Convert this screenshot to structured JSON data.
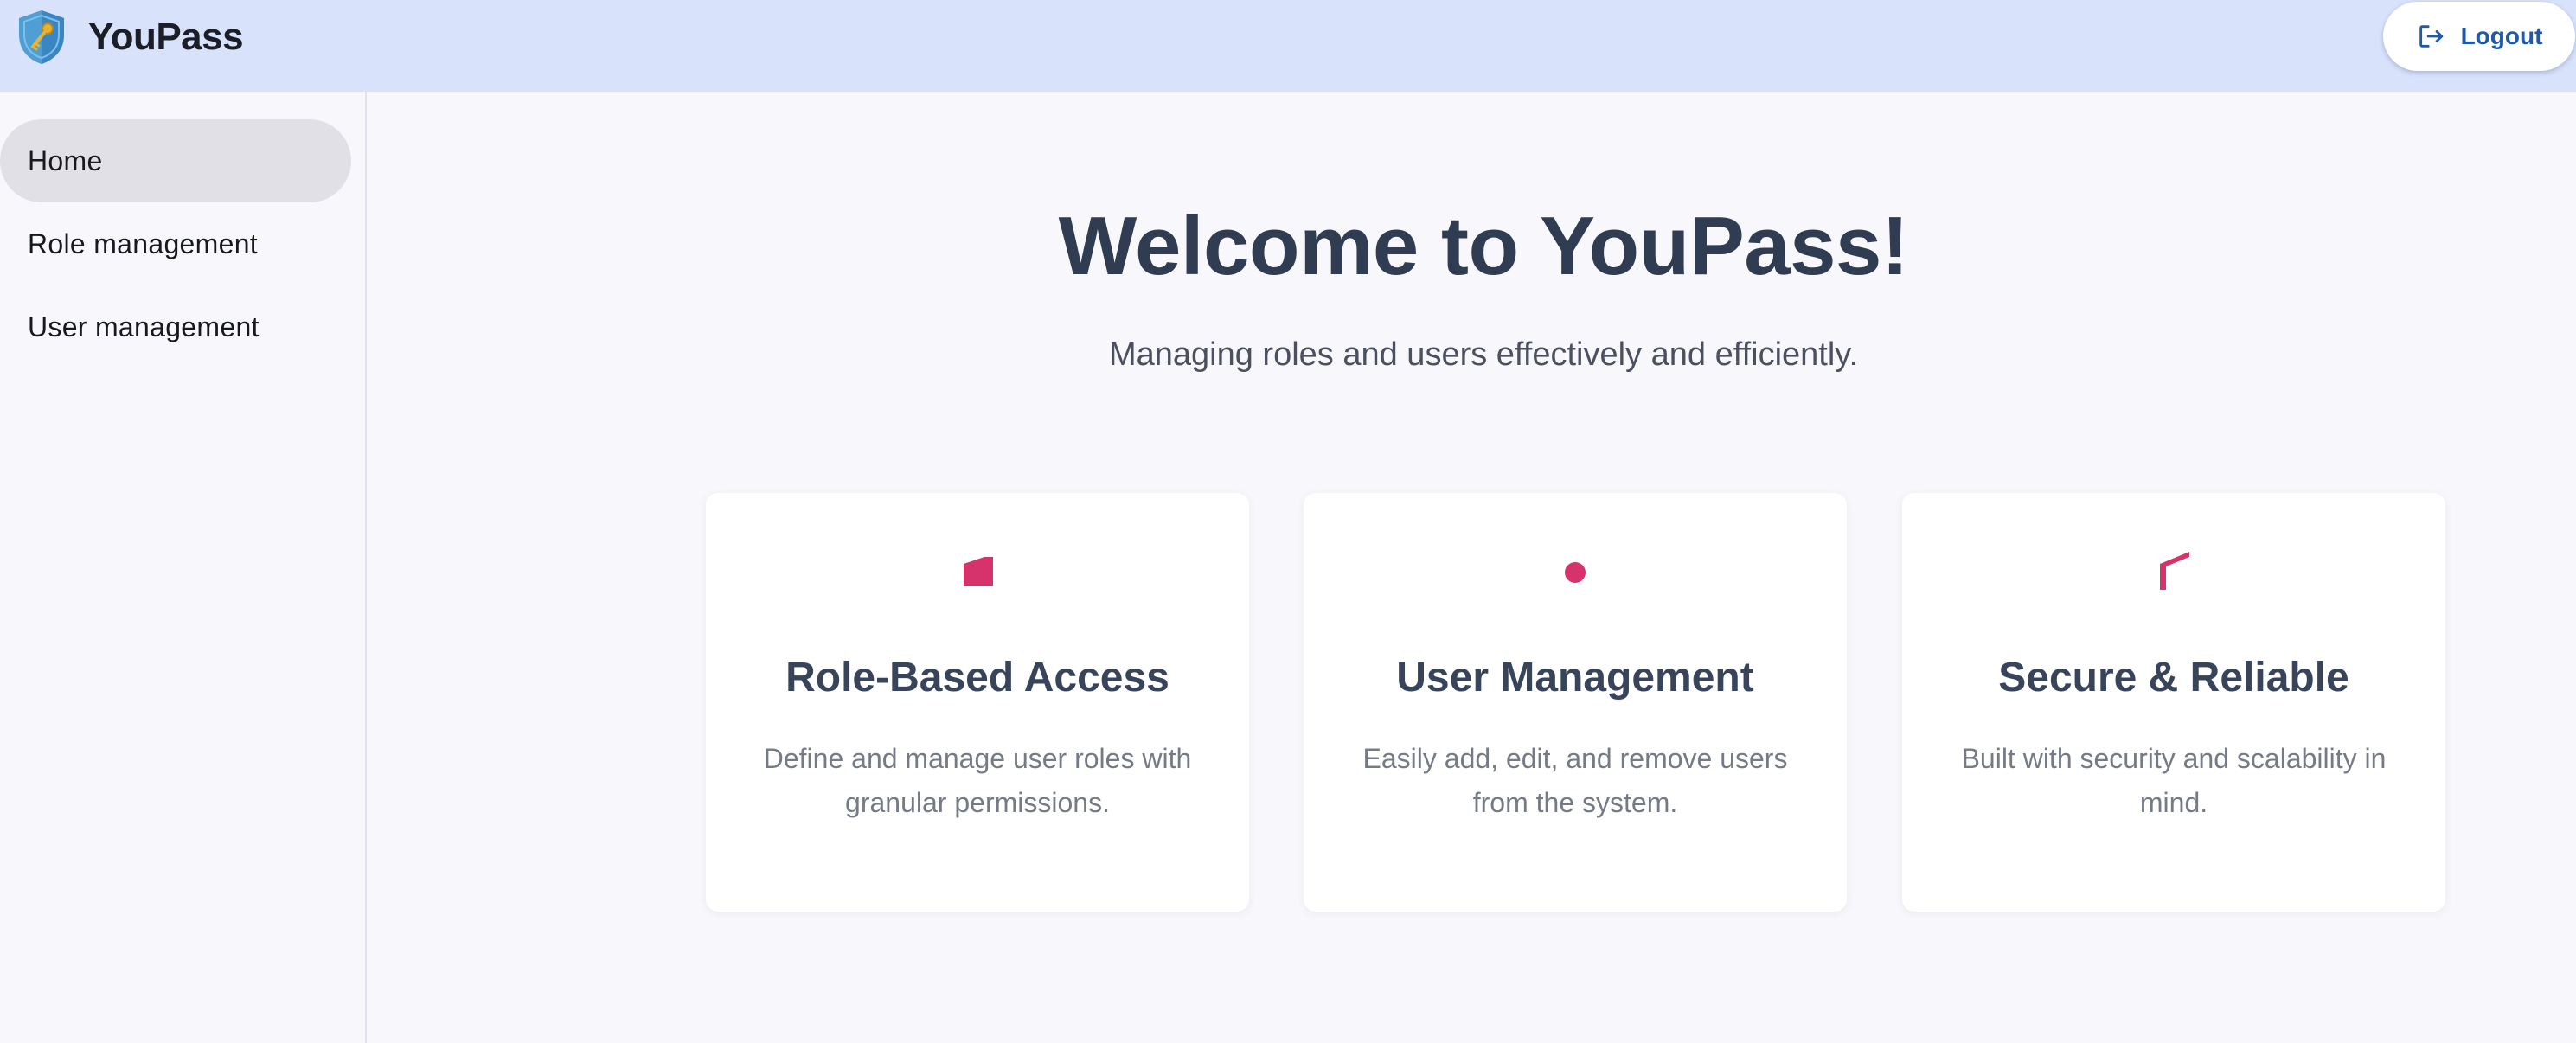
{
  "header": {
    "app_name": "YouPass",
    "logo_icon": "shield-key-icon",
    "logout_label": "Logout",
    "logout_icon": "logout-icon"
  },
  "sidebar": {
    "items": [
      {
        "label": "Home",
        "active": true
      },
      {
        "label": "Role management",
        "active": false
      },
      {
        "label": "User management",
        "active": false
      }
    ]
  },
  "main": {
    "title": "Welcome to YouPass!",
    "subtitle": "Managing roles and users effectively and efficiently.",
    "cards": [
      {
        "icon": "role-access-icon",
        "title": "Role-Based Access",
        "description": "Define and manage user roles with granular permissions."
      },
      {
        "icon": "user-icon",
        "title": "User Management",
        "description": "Easily add, edit, and remove users from the system."
      },
      {
        "icon": "security-icon",
        "title": "Secure & Reliable",
        "description": "Built with security and scalability in mind."
      }
    ]
  },
  "colors": {
    "header_bg": "#d8e2fa",
    "page_bg": "#f8f8fc",
    "accent": "#d6336c",
    "heading": "#2f3c52",
    "logout_text": "#1f5aa8",
    "active_nav_bg": "#e1e0e6"
  }
}
